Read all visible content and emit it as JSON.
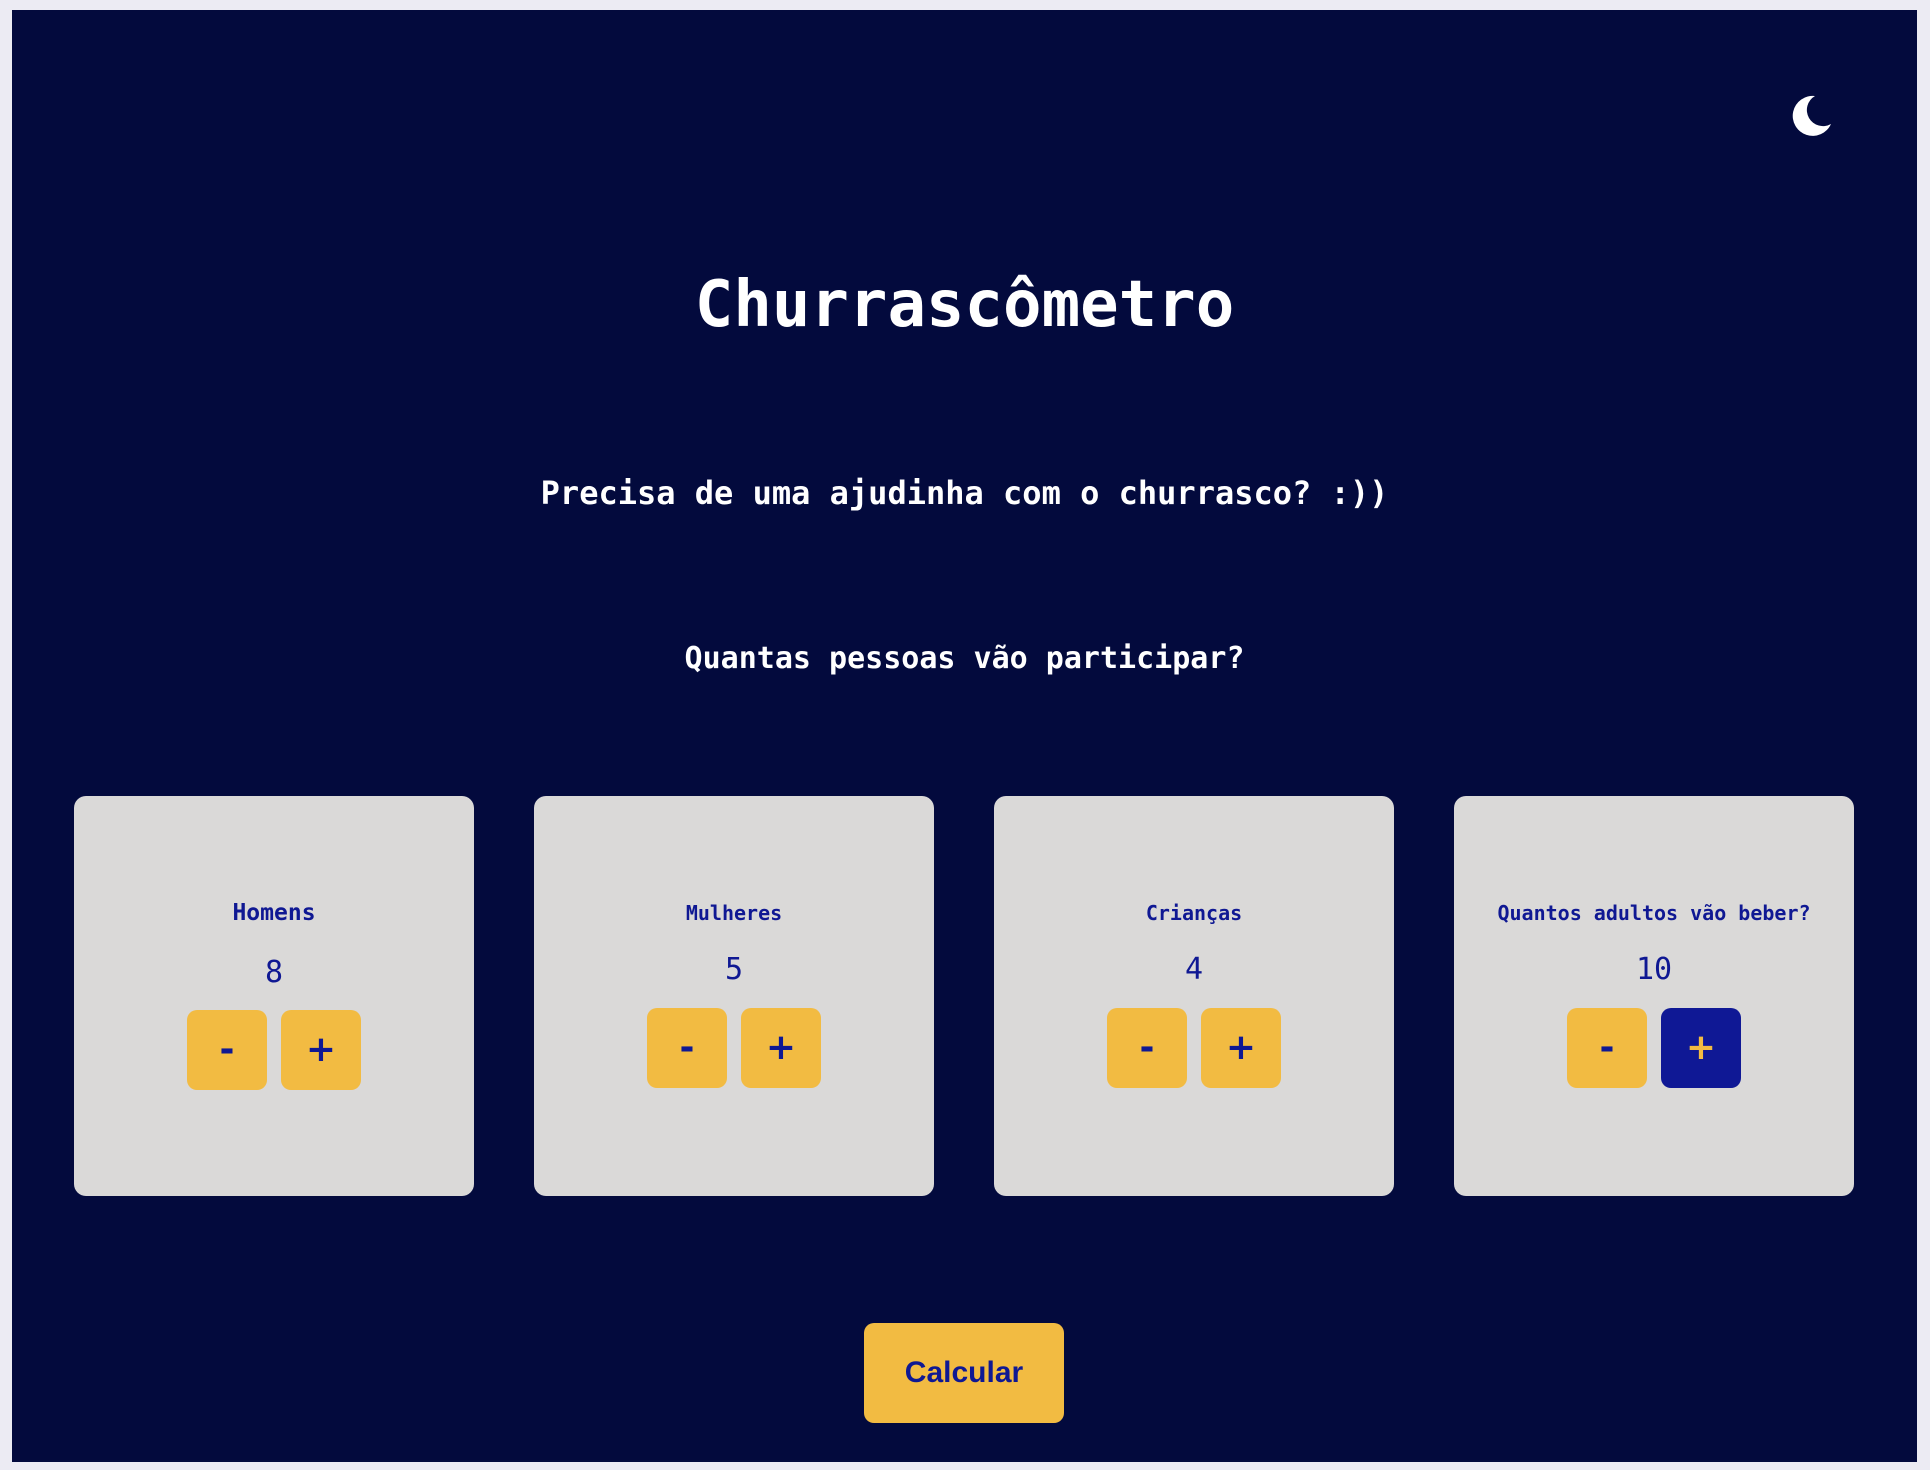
{
  "header": {
    "theme_toggle_icon": "moon-icon"
  },
  "title": "Churrascômetro",
  "subtitle": "Precisa de uma ajudinha com o churrasco? :))",
  "question": "Quantas pessoas vão participar?",
  "cards": [
    {
      "label": "Homens",
      "value": "8",
      "minus": "-",
      "plus": "+"
    },
    {
      "label": "Mulheres",
      "value": "5",
      "minus": "-",
      "plus": "+"
    },
    {
      "label": "Crianças",
      "value": "4",
      "minus": "-",
      "plus": "+"
    },
    {
      "label": "Quantos adultos vão beber?",
      "value": "10",
      "minus": "-",
      "plus": "+"
    }
  ],
  "calculate_label": "Calcular",
  "colors": {
    "background": "#030a3d",
    "card": "#dad9d8",
    "accent_yellow": "#f2bb42",
    "accent_blue": "#0f1893"
  }
}
